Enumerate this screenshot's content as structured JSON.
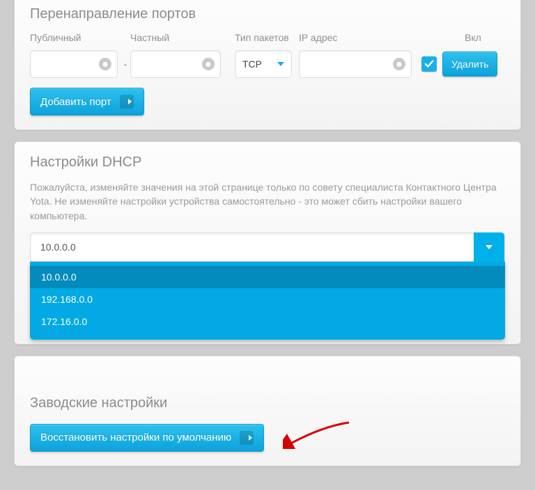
{
  "port_forwarding": {
    "title": "Перенаправление портов",
    "headers": {
      "public": "Публичный",
      "private": "Частный",
      "packet_type": "Тип пакетов",
      "ip_address": "IP адрес",
      "enable": "Вкл"
    },
    "row": {
      "public_value": "",
      "private_value": "",
      "packet_type_value": "TCP",
      "ip_value": "",
      "enabled": true
    },
    "delete_label": "Удалить",
    "add_label": "Добавить порт"
  },
  "dhcp": {
    "title": "Настройки DHCP",
    "description": "Пожалуйста, изменяйте значения на этой странице только по совету специалиста Контактного Центра Yota. Не изменяйте настройки устройства самостоятельно - это может сбить настройки вашего компьютера.",
    "selected": "10.0.0.0",
    "options": [
      "10.0.0.0",
      "192.168.0.0",
      "172.16.0.0"
    ]
  },
  "factory": {
    "title": "Заводские настройки",
    "restore_label": "Восстановить настройки по умолчанию"
  }
}
